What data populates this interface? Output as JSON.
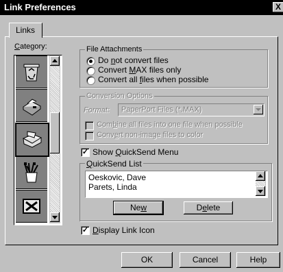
{
  "window": {
    "title": "Link Preferences",
    "close_glyph": "X"
  },
  "tabs": [
    {
      "label": "Links"
    }
  ],
  "category": {
    "label_u": "C",
    "label_rest": "ategory:",
    "items": [
      {
        "icon": "recycle-bin-icon"
      },
      {
        "icon": "fax-machine-icon"
      },
      {
        "icon": "email-envelope-icon"
      },
      {
        "icon": "applications-cup-icon"
      },
      {
        "icon": "spreadsheet-app-icon"
      }
    ]
  },
  "file_attachments": {
    "title": "File Attachments",
    "options": [
      {
        "pre": "Do ",
        "u": "n",
        "post": "ot convert files",
        "selected": true
      },
      {
        "pre": "Convert ",
        "u": "M",
        "post": "AX files only",
        "selected": false
      },
      {
        "pre": "Convert all ",
        "u": "f",
        "post": "iles when possible",
        "selected": false
      }
    ]
  },
  "conversion_options": {
    "title": "Conversion Options",
    "format_label": "Format:",
    "format_value": "PaperPort Files (*.MAX)",
    "combine_u": "b",
    "combine_pre": "Com",
    "combine_post": "ine all files into one file when possible",
    "convert_u": "e",
    "convert_pre": "Conv",
    "convert_post": "rt non-image files to color"
  },
  "show_quicksend": {
    "pre": "Show ",
    "u": "Q",
    "post": "uickSend Menu",
    "checked": true
  },
  "quicksend_list": {
    "title_u": "Q",
    "title_rest": "uickSend List",
    "entries": [
      "Oeskovic, Dave",
      "Parets, Linda"
    ],
    "new_pre": "Ne",
    "new_u": "w",
    "delete_pre": "D",
    "delete_u": "e",
    "delete_post": "lete"
  },
  "display_link_icon": {
    "u": "D",
    "post": "isplay Link Icon",
    "checked": true
  },
  "footer": {
    "ok": "OK",
    "cancel": "Cancel",
    "help": "Help"
  }
}
